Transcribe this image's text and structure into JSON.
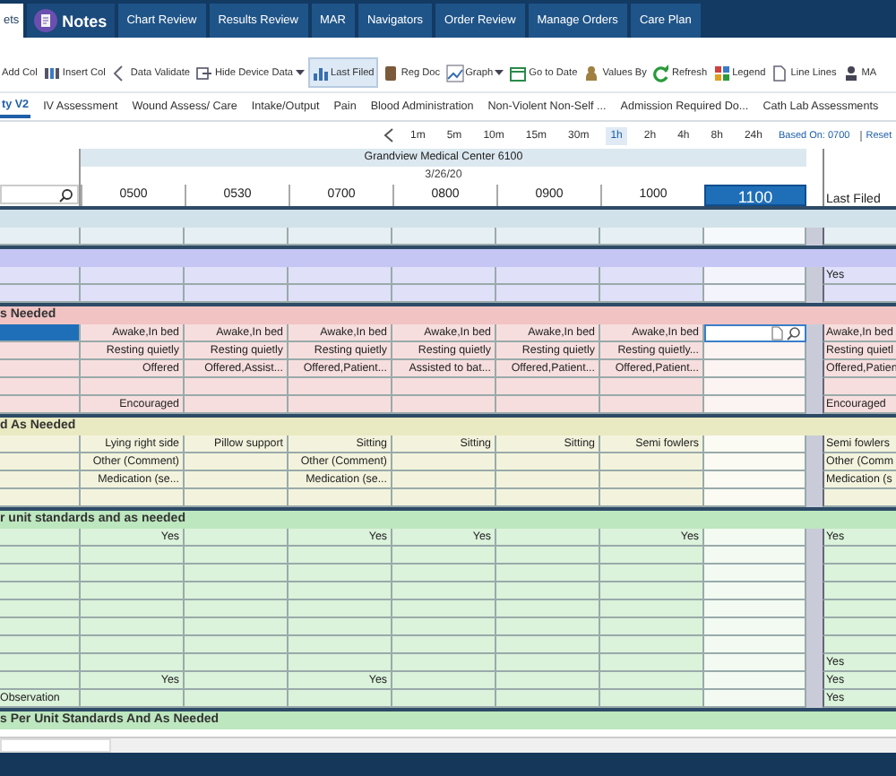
{
  "top_tabs": [
    {
      "label": "ets",
      "selected": true
    },
    {
      "label": "Notes",
      "selected": false,
      "kind": "icon"
    },
    {
      "label": "Chart Review",
      "selected": false,
      "kind": "plain"
    },
    {
      "label": "Results Review",
      "selected": false,
      "kind": "plain"
    },
    {
      "label": "MAR",
      "selected": false,
      "kind": "plain"
    },
    {
      "label": "Navigators",
      "selected": false,
      "kind": "plain"
    },
    {
      "label": "Order Review",
      "selected": false,
      "kind": "plain"
    },
    {
      "label": "Manage Orders",
      "selected": false,
      "kind": "plain"
    },
    {
      "label": "Care Plan",
      "selected": false,
      "kind": "plain"
    }
  ],
  "toolbar": [
    {
      "label": "Add Col",
      "selected": false,
      "dropdown": false
    },
    {
      "label": "Insert Col",
      "selected": false,
      "dropdown": false
    },
    {
      "label": "Data Validate",
      "selected": false,
      "dropdown": false
    },
    {
      "label": "Hide Device Data",
      "selected": false,
      "dropdown": true
    },
    {
      "label": "Last Filed",
      "selected": true,
      "dropdown": false
    },
    {
      "label": "Reg Doc",
      "selected": false,
      "dropdown": false
    },
    {
      "label": "Graph",
      "selected": false,
      "dropdown": true
    },
    {
      "label": "Go to Date",
      "selected": false,
      "dropdown": false
    },
    {
      "label": "Values By",
      "selected": false,
      "dropdown": false
    },
    {
      "label": "Refresh",
      "selected": false,
      "dropdown": false
    },
    {
      "label": "Legend",
      "selected": false,
      "dropdown": false
    },
    {
      "label": "Line Lines",
      "selected": false,
      "dropdown": false
    },
    {
      "label": "MA",
      "selected": false,
      "dropdown": false
    }
  ],
  "section_tabs": [
    {
      "label": "ty V2",
      "selected": true
    },
    {
      "label": "IV Assessment",
      "selected": false
    },
    {
      "label": "Wound Assess/ Care",
      "selected": false
    },
    {
      "label": "Intake/Output",
      "selected": false
    },
    {
      "label": "Pain",
      "selected": false
    },
    {
      "label": "Blood Administration",
      "selected": false
    },
    {
      "label": "Non-Violent Non-Self ...",
      "selected": false
    },
    {
      "label": "Admission Required Do...",
      "selected": false
    },
    {
      "label": "Cath Lab Assessments",
      "selected": false
    }
  ],
  "intervals": {
    "items": [
      {
        "label": "1m",
        "selected": false
      },
      {
        "label": "5m",
        "selected": false
      },
      {
        "label": "10m",
        "selected": false
      },
      {
        "label": "15m",
        "selected": false
      },
      {
        "label": "30m",
        "selected": false
      },
      {
        "label": "1h",
        "selected": true
      },
      {
        "label": "2h",
        "selected": false
      },
      {
        "label": "4h",
        "selected": false
      },
      {
        "label": "8h",
        "selected": false
      },
      {
        "label": "24h",
        "selected": false
      }
    ],
    "based_on": "Based On: 0700",
    "reset": "Reset"
  },
  "grid": {
    "location": "Grandview Medical Center 6100",
    "date": "3/26/20",
    "columns": [
      {
        "label": "0500",
        "selected": false
      },
      {
        "label": "0530",
        "selected": false
      },
      {
        "label": "0700",
        "selected": false
      },
      {
        "label": "0800",
        "selected": false
      },
      {
        "label": "0900",
        "selected": false
      },
      {
        "label": "1000",
        "selected": false
      },
      {
        "label": "1100",
        "selected": true
      }
    ],
    "last_filed_label": "Last Filed",
    "sections": [
      {
        "color": "#d2e2ea",
        "rows": [
          {
            "selected": false,
            "cells": [
              null,
              null,
              null,
              null,
              null,
              null,
              null
            ]
          }
        ]
      },
      {
        "color": "#c6c6f4",
        "rows": [
          {
            "selected": false,
            "cells": [
              null,
              null,
              null,
              null,
              null,
              null,
              null
            ],
            "last": "Yes"
          },
          {
            "selected": false,
            "cells": [
              null,
              null,
              null,
              null,
              null,
              null,
              null
            ]
          }
        ]
      },
      {
        "title": "s Needed",
        "color": "#f1c3c3",
        "rows": [
          {
            "selected": true,
            "cells": [
              "Awake,In bed",
              "Awake,In bed",
              "Awake,In bed",
              "Awake,In bed",
              "Awake,In bed",
              "Awake,In bed",
              null
            ],
            "last": "Awake,In bed"
          },
          {
            "selected": false,
            "cells": [
              "Resting quietly",
              "Resting quietly",
              "Resting quietly",
              "Resting quietly",
              "Resting quietly",
              "Resting quietly...",
              null
            ],
            "last": "Resting quietl"
          },
          {
            "selected": false,
            "cells": [
              "Offered",
              "Offered,Assist...",
              "Offered,Patient...",
              "Assisted to bat...",
              "Offered,Patient...",
              "Offered,Patient...",
              null
            ],
            "last": "Offered,Patien"
          },
          {
            "selected": false,
            "cells": [
              null,
              null,
              null,
              null,
              null,
              null,
              null
            ]
          },
          {
            "selected": false,
            "cells": [
              "Encouraged",
              null,
              null,
              null,
              null,
              null,
              null
            ],
            "last": "Encouraged"
          }
        ]
      },
      {
        "title": "d As Needed",
        "color": "#eaeac2",
        "rows": [
          {
            "selected": false,
            "cells": [
              "Lying right side",
              "Pillow support",
              "Sitting",
              "Sitting",
              "Sitting",
              "Semi fowlers",
              null
            ],
            "last": "Semi fowlers"
          },
          {
            "selected": false,
            "cells": [
              "Other (Comment)",
              null,
              "Other (Comment)",
              null,
              null,
              null,
              null
            ],
            "last": "Other (Comm"
          },
          {
            "selected": false,
            "cells": [
              "Medication (se...",
              null,
              "Medication (se...",
              null,
              null,
              null,
              null
            ],
            "last": "Medication (s"
          },
          {
            "selected": false,
            "cells": [
              null,
              null,
              null,
              null,
              null,
              null,
              null
            ]
          }
        ]
      },
      {
        "title": "r unit standards and as needed",
        "color": "#bde7be",
        "rows": [
          {
            "selected": false,
            "cells": [
              "Yes",
              null,
              "Yes",
              "Yes",
              null,
              "Yes",
              null
            ],
            "last": "Yes"
          },
          {
            "selected": false,
            "cells": [
              null,
              null,
              null,
              null,
              null,
              null,
              null
            ]
          },
          {
            "selected": false,
            "cells": [
              null,
              null,
              null,
              null,
              null,
              null,
              null
            ]
          },
          {
            "selected": false,
            "cells": [
              null,
              null,
              null,
              null,
              null,
              null,
              null
            ]
          },
          {
            "selected": false,
            "cells": [
              null,
              null,
              null,
              null,
              null,
              null,
              null
            ]
          },
          {
            "selected": false,
            "cells": [
              null,
              null,
              null,
              null,
              null,
              null,
              null
            ]
          },
          {
            "selected": false,
            "cells": [
              null,
              null,
              null,
              null,
              null,
              null,
              null
            ]
          },
          {
            "selected": false,
            "cells": [
              null,
              null,
              null,
              null,
              null,
              null,
              null
            ],
            "last": "Yes"
          },
          {
            "selected": false,
            "cells": [
              "Yes",
              null,
              "Yes",
              null,
              null,
              null,
              null
            ],
            "last": "Yes"
          },
          {
            "selected": false,
            "label": "Observation",
            "cells": [
              null,
              null,
              null,
              null,
              null,
              null,
              null
            ],
            "last": "Yes"
          }
        ]
      },
      {
        "title": "s Per Unit Standards And As Needed",
        "color": "#bde7be"
      }
    ]
  }
}
